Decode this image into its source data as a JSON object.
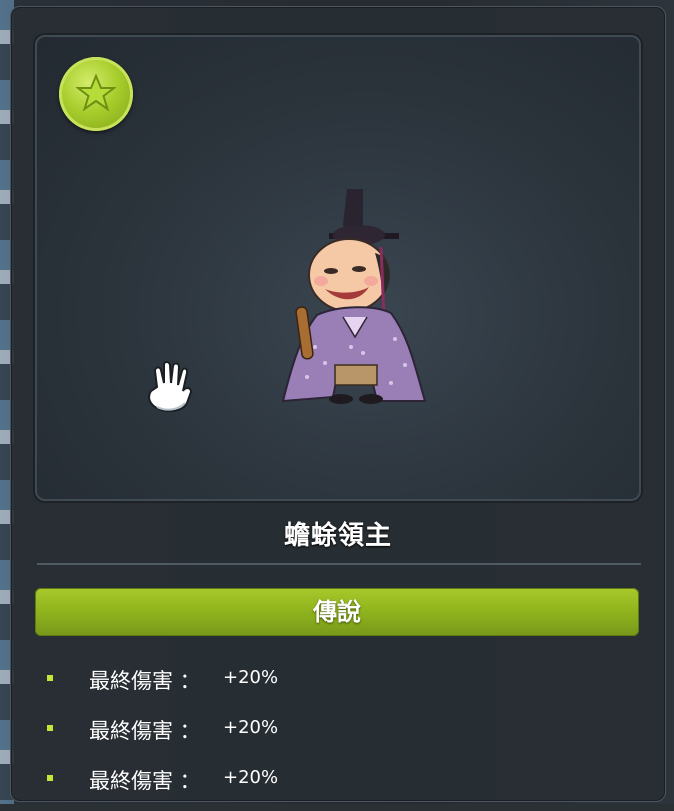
{
  "item": {
    "name": "蟾蜍領主",
    "grade": "傳說",
    "potentials": [
      {
        "label": "最終傷害 ：",
        "value": "+20%"
      },
      {
        "label": "最終傷害 ：",
        "value": "+20%"
      },
      {
        "label": "最終傷害 ：",
        "value": "+20%"
      }
    ]
  },
  "colors": {
    "grade_bar": "#8fb31d",
    "bullet": "#c8e63a",
    "badge": "#a7cd2c"
  },
  "icons": [
    "star-icon",
    "glove-cursor-icon"
  ]
}
